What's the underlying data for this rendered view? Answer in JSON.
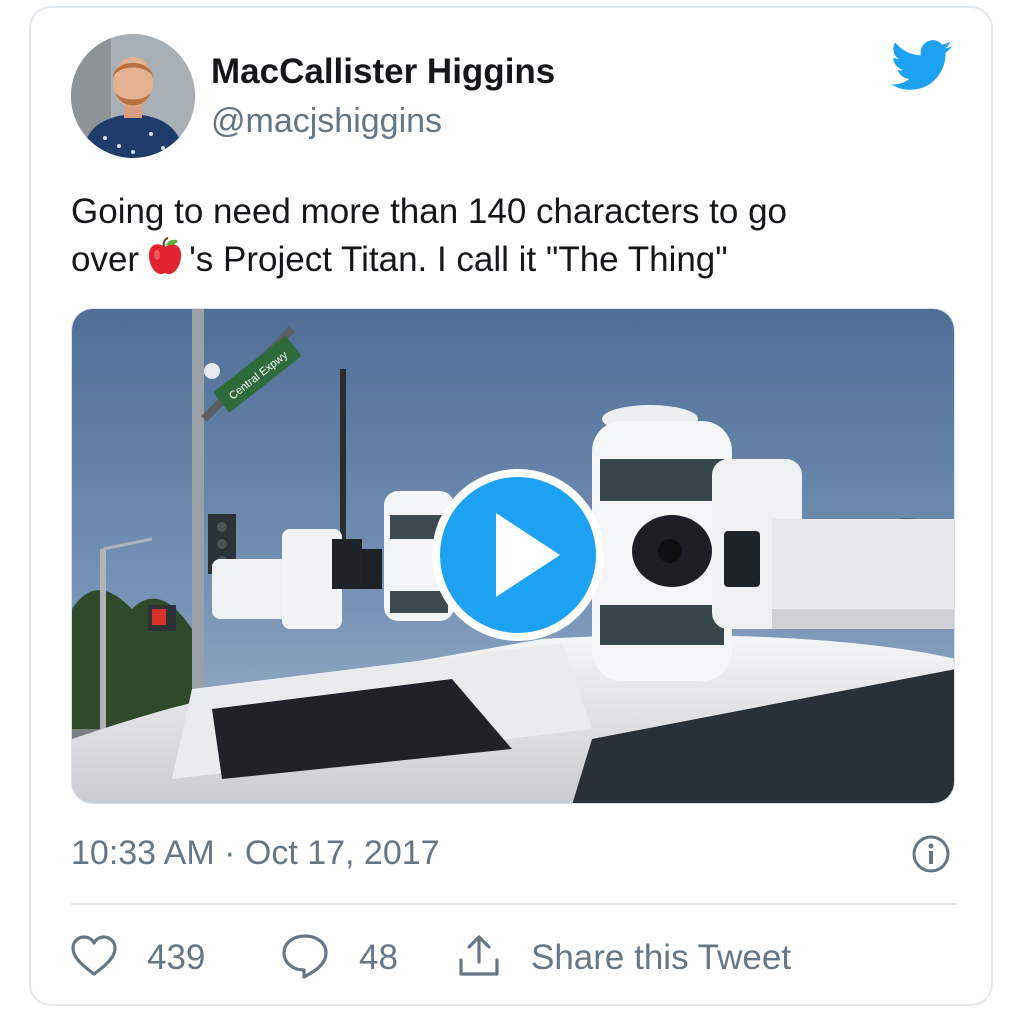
{
  "tweet": {
    "author": {
      "display_name": "MacCallister Higgins",
      "handle": "@macjshiggins"
    },
    "text_line1": "Going to need more than 140 characters to go",
    "text_line2_before": "over",
    "text_line2_after": "'s Project Titan. I call it \"The Thing\"",
    "emoji": "red-apple",
    "media": {
      "type": "video",
      "street_sign": "Central Expy"
    },
    "timestamp": "10:33 AM · Oct 17, 2017",
    "likes": "439",
    "replies": "48",
    "share_label": "Share this Tweet"
  },
  "colors": {
    "twitter_blue": "#1da1f2",
    "text": "#14171a",
    "secondary_text": "#657786",
    "border": "#e1e8ed"
  },
  "icons": [
    "twitter-bird-icon",
    "play-icon",
    "info-icon",
    "heart-icon",
    "reply-icon",
    "share-icon"
  ]
}
